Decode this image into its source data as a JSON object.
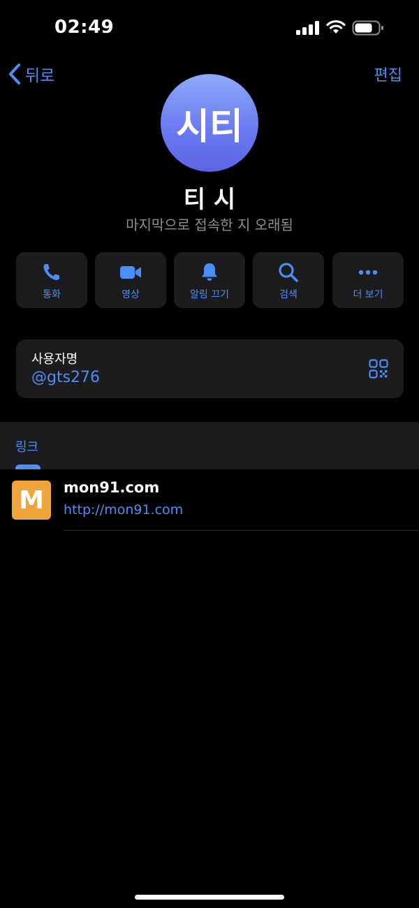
{
  "status_bar": {
    "time": "02:49"
  },
  "nav": {
    "back_label": "뒤로",
    "edit_label": "편집"
  },
  "profile": {
    "avatar_initials": "시티",
    "name": "티 시",
    "last_seen": "마지막으로 접속한 지 오래됨"
  },
  "actions": [
    {
      "label": "통화",
      "icon": "phone-icon"
    },
    {
      "label": "영상",
      "icon": "video-camera-icon"
    },
    {
      "label": "알림 끄기",
      "icon": "bell-icon"
    },
    {
      "label": "검색",
      "icon": "search-icon"
    },
    {
      "label": "더 보기",
      "icon": "more-icon"
    }
  ],
  "username": {
    "title": "사용자명",
    "value": "@gts276",
    "icon": "qr-code-icon"
  },
  "links": {
    "tab_label": "링크",
    "items": [
      {
        "thumb_letter": "M",
        "title": "mon91.com",
        "url": "http://mon91.com"
      }
    ]
  },
  "colors": {
    "accent": "#4b8ef5",
    "background": "#000000",
    "card": "#1c1c1e",
    "secondary_text": "#8e8e93",
    "link_thumb": "#f0a53a"
  }
}
